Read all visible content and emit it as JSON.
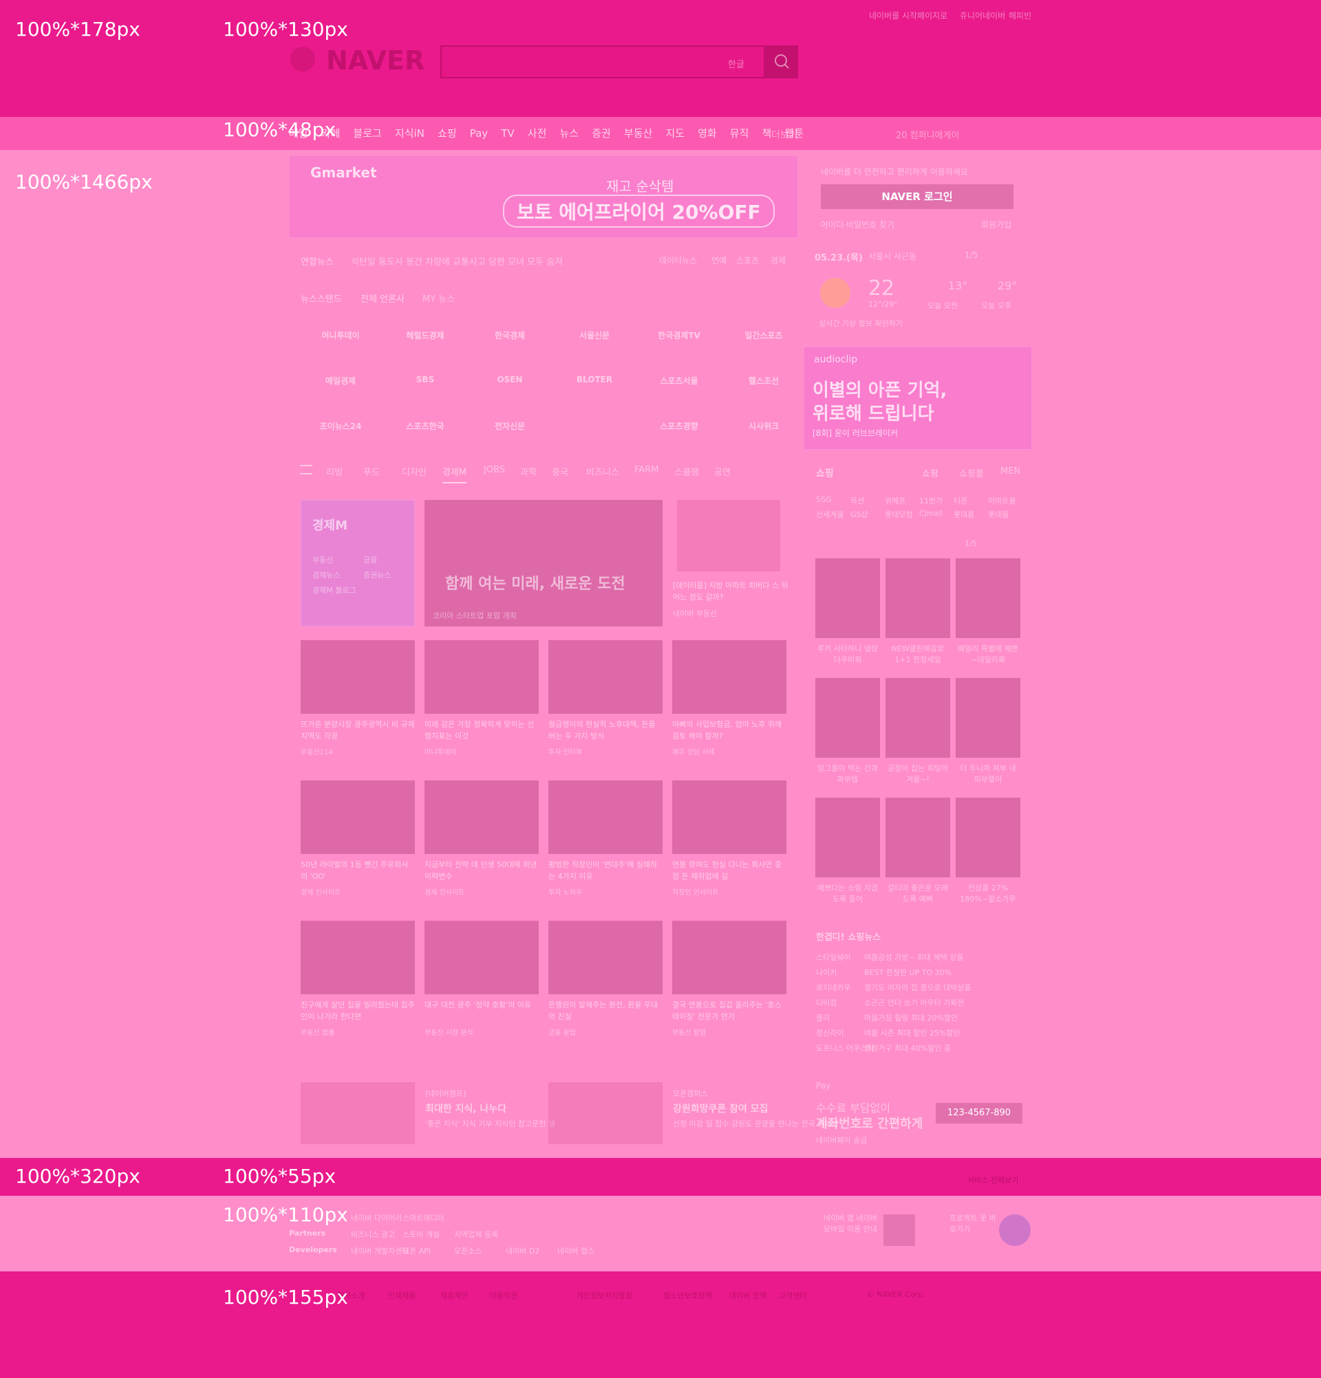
{
  "overlay_labels": {
    "header_full": "100%*178px",
    "header_inner": "100%*130px",
    "nav": "100%*48px",
    "main": "100%*1466px",
    "footer_full": "100%*320px",
    "footer_top": "100%*55px",
    "footer_mid": "100%*110px",
    "footer_bottom": "100%*155px"
  },
  "header": {
    "top_links": [
      "네이버를 시작페이지로",
      "쥬니어네이버",
      "해피빈"
    ],
    "logo": "NAVER",
    "search_placeholder": "",
    "keyboard": "한글"
  },
  "nav": {
    "items": [
      "메일",
      "카페",
      "블로그",
      "지식iN",
      "쇼핑",
      "Pay",
      "TV",
      "사전",
      "뉴스",
      "증권",
      "부동산",
      "지도",
      "영화",
      "뮤직",
      "책",
      "웹툰"
    ],
    "more": "더보기",
    "ad_text": "20 컴퍼니에게이"
  },
  "banner": {
    "brand": "Gmarket",
    "sub": "재고 순삭템",
    "headline": "보토 에어프라이어 20%OFF"
  },
  "ticker": {
    "source": "연합뉴스",
    "headline": "석탄일 동도사 봉간 차량에 교통사고 당한 모녀 모두 숨져",
    "tabs": [
      "데이터뉴스",
      "연예",
      "스포츠",
      "경제"
    ]
  },
  "newsstand": {
    "label": "뉴스스탠드",
    "all": "전체 언론사",
    "my": "MY 뉴스",
    "press": [
      "머니투데이",
      "헤럴드경제",
      "한국경제",
      "서울신문",
      "한국경제TV",
      "일간스포츠",
      "매일경제",
      "SBS",
      "OSEN",
      "BLOTER",
      "스포츠서울",
      "헬스조선",
      "조이뉴스24",
      "스포츠한국",
      "전자신문",
      "",
      "스포츠경향",
      "시사위크"
    ]
  },
  "login": {
    "notice": "네이버를 더 안전하고 편리하게 이용하세요",
    "button": "NAVER 로그인",
    "find": "아이디·비밀번호 찾기",
    "join": "회원가입"
  },
  "weather": {
    "date": "05.23.(목)",
    "location": "서울시 사근동",
    "page": "1/5",
    "temp": "22",
    "range": "12°/29°",
    "am_temp": "13°",
    "am_label": "오늘 오전",
    "pm_temp": "29°",
    "pm_label": "오늘 오후",
    "alert": "실시간 기상 정보 확인하기"
  },
  "audioclip": {
    "brand": "audioclip",
    "line1": "이별의 아픈 기억,",
    "line2": "위로해 드립니다",
    "sub": "[8회] 윤이 러브브레이커"
  },
  "categories": {
    "items": [
      "리빙",
      "푸드",
      "디자인",
      "경제M",
      "JOBS",
      "과학",
      "중국",
      "비즈니스",
      "FARM",
      "스쿨잼",
      "공연"
    ],
    "active": "경제M"
  },
  "featured": {
    "title": "경제M",
    "links": [
      "부동산",
      "금융",
      "경제뉴스",
      "증권뉴스",
      "경제M 블로그"
    ]
  },
  "main_story": {
    "headline": "함께 여는 미래, 새로운 도전",
    "caption": "코리아 스타트업 포럼 개최",
    "side_title": "[데이터룸] 지방 아파트 피버다 스 뒤 어느 정도 갈까?",
    "side_source": "네이버 부동산"
  },
  "articles": [
    {
      "title": "뜨거운 분양시장 광주광역시 비 규제지역도 각광",
      "source": "부동산114"
    },
    {
      "title": "미래 검은 가장 정확하게 맞히는 선행지표는 이것",
      "source": "머니투데이"
    },
    {
      "title": "월급쟁이의 현실적 노후대책, 돈을 버는 두 가지 방식",
      "source": "투자 인터뷰"
    },
    {
      "title": "아빠의 사업보험금, 엄마 노후 위해 검토 해야 할까?",
      "source": "재무 상담 사례"
    },
    {
      "title": "50년 라이벌의 1등 뺏긴 주유회사의 'OO'",
      "source": "경제 인사이트"
    },
    {
      "title": "지금부터 전략 데 인생 50대에 퍼낸 이력변수",
      "source": "경제 인사이트"
    },
    {
      "title": "평범한 직장인이 '연대주'에 실패하는 4가지 이유",
      "source": "투자 노하우"
    },
    {
      "title": "연봉 깎여도 현실 다니는 회사만 중점 돈 재취업에 길",
      "source": "직장인 인사이트"
    },
    {
      "title": "친구에게 살던 집을 빌려줬는데 집주인이 나가라 한다면",
      "source": "부동산 법률"
    },
    {
      "title": "대구 대전 광주 '정약 호황'의 이유",
      "source": "부동산 시장 분석"
    },
    {
      "title": "은행원이 말해주는 환전, 환율 우대의 진실",
      "source": "금융 꿀팁"
    },
    {
      "title": "결국 연봉으로 집값 올라주는 '호스테이징' 전문가 연기",
      "source": "부동산 칼럼"
    }
  ],
  "promo": [
    {
      "tag": "[네이버캠프]",
      "title": "최대한 지식, 나누다",
      "desc": "'좋은 지식' 지식 기부 지식인 참고문헌 생"
    },
    {
      "tag": "오픈캠퍼스",
      "title": "강원희망쿠폰 참여 모집",
      "desc": "신청 마감 일 접수 강원도 관광을 만나는 전국 캠페인"
    }
  ],
  "shopping": {
    "title": "쇼핑",
    "tabs": [
      "쇼핑",
      "쇼핑몰",
      "MEN"
    ],
    "malls": [
      "SSG",
      "옥션",
      "위메프",
      "11번가",
      "티몬",
      "이마트몰",
      "신세계몰",
      "GS샵",
      "롯데닷컴",
      "CJmall",
      "롯데홈",
      "롯데몰"
    ],
    "page": "1/5",
    "items": [
      {
        "name": "루키 사타하니 냉장 더쿠미워"
      },
      {
        "name": "NEW클린메갈로 1+1 한정세일"
      },
      {
        "name": "패밀리 특별에 예쁜~데일리룩"
      },
      {
        "name": "잉그롤이 먹는 간과 파부템"
      },
      {
        "name": "공장이 집는 피팅의 겨울~!"
      },
      {
        "name": "더 두니까 처부 내 피부젤이"
      },
      {
        "name": "예쁘다는 소림 지겹도록 들어"
      },
      {
        "name": "걸티미 좋은운 오래도록 예뻐"
      },
      {
        "name": "전상품 27% 180%~할소가루"
      }
    ]
  },
  "shopnews": {
    "title": "한겹다! 쇼핑뉴스",
    "rows": [
      [
        "스타일쉐어",
        "여름감성 가방~ 최대 혜택 상품"
      ],
      [
        "나이키",
        "BEST 한정판 UP TO 30%"
      ],
      [
        "로지네카우",
        "경기도 여자의 집 증으로 대박상품"
      ],
      [
        "디비컴",
        "소곤곤 언더 쏘기 아우터 기획전"
      ],
      [
        "플리",
        "마음가짐 힐링 최대 20%할인"
      ],
      [
        "정신라이",
        "여름 시즌 최대 할인 25%할인"
      ],
      [
        "도프니스 어쿠스틱",
        "정원가구 최대 40%할인 중"
      ]
    ]
  },
  "pay_ad": {
    "brand": "Pay",
    "line1": "수수료 부담없이",
    "line2": "계좌번호로 간편하게",
    "sub": "네이버페이 송금",
    "number": "123-4567-890"
  },
  "footer": {
    "service_link": "서비스 전체보기",
    "rows": [
      {
        "label": "",
        "links": [
          "네이버 다이어리",
          "스마트에디터"
        ]
      },
      {
        "label": "Partners",
        "links": [
          "비즈니스 광고",
          "스토어 개설",
          "지역업체 등록"
        ]
      },
      {
        "label": "Developers",
        "links": [
          "네이버 개발자센터",
          "오픈 API",
          "오픈소스",
          "네이버 D2",
          "네이버 랩스"
        ]
      }
    ],
    "app1": "네이버 앱 네이버모바일 이용 안내",
    "app2": "프로젝트 꽃 바로가기",
    "bottom": [
      "회사소개",
      "인재채용",
      "제휴제안",
      "이용약관",
      "개인정보처리방침",
      "청소년보호정책",
      "네이버 정책",
      "고객센터",
      "© NAVER Corp."
    ]
  }
}
